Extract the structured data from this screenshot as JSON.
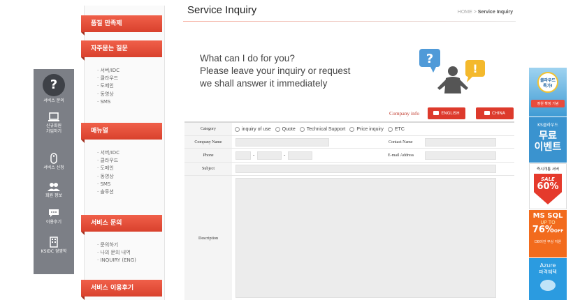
{
  "left_nav": {
    "items": [
      {
        "label": "서비스 문의",
        "icon": "question-icon"
      },
      {
        "label": "신규회원\n가입하기",
        "icon": "laptop-icon"
      },
      {
        "label": "서비스 신청",
        "icon": "mouse-icon"
      },
      {
        "label": "회원 정보",
        "icon": "users-icon"
      },
      {
        "label": "이용후기",
        "icon": "chat-icon"
      },
      {
        "label": "KSIDC 경영학",
        "icon": "building-icon"
      }
    ]
  },
  "sidebar": {
    "sections": [
      {
        "title": "품질 만족제",
        "items": []
      },
      {
        "title": "자주묻는 질문",
        "items": [
          "· 서버/IDC",
          "· 클라우드",
          "· 도메인",
          "· 동영상",
          "· SMS"
        ]
      },
      {
        "title": "매뉴얼",
        "items": [
          "· 서버/IDC",
          "· 클라우드",
          "· 도메인",
          "· 동영상",
          "· SMS",
          "· 솔루션"
        ]
      },
      {
        "title": "서비스 문의",
        "items": [
          "· 문의하기",
          "· 나의 문의 내역",
          "· INQUIRY (ENG)"
        ]
      },
      {
        "title": "서비스 이용후기",
        "items": []
      }
    ]
  },
  "header": {
    "title": "Service Inquiry",
    "breadcrumb_home": "HOME",
    "breadcrumb_sep": ">",
    "breadcrumb_current": "Service Inquiry"
  },
  "intro": {
    "line1": "What can I do for you?",
    "line2": "Please leave your inquiry or  request",
    "line3": "we shall answer it immediately"
  },
  "company_info": {
    "label": "Company info",
    "english": "ENGLISH",
    "china": "CHINA"
  },
  "form": {
    "category_label": "Category",
    "category_options": [
      "inquiry of use",
      "Quote",
      "Technical Support",
      "Price inquiry",
      "ETC"
    ],
    "company_name_label": "Company Name",
    "contact_name_label": "Contact Name",
    "phone_label": "Phone",
    "email_label": "E-mail Address",
    "subject_label": "Subject",
    "description_label": "Description",
    "phone_sep": "-"
  },
  "banners": {
    "b1_line1": "클라우드",
    "b1_line2": "특가!",
    "b1_ribbon": "정원 확정 기념",
    "b2_top": "KS클라우드",
    "b2_l1": "무료",
    "b2_l2": "이벤트",
    "b3_top": "즉시개통 서버",
    "b3_sale": "SALE",
    "b3_pct": "60%",
    "b4_l1": "MS SQL",
    "b4_l2": "UP TO",
    "b4_pct": "76%",
    "b4_off": "OFF",
    "b4_foot": "DB이전 무상 지원",
    "b5_l1": "Azure",
    "b5_l2": "파격혜택"
  },
  "colors": {
    "accent_red": "#dd3a2c",
    "nav_gray": "#7c7f86",
    "banner_blue": "#3a93cf",
    "banner_orange": "#f26b1d"
  }
}
